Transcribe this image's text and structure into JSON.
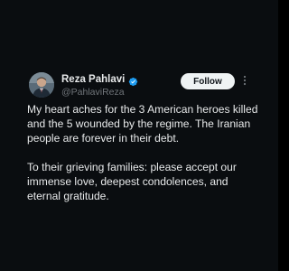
{
  "author": {
    "display_name": "Reza Pahlavi",
    "handle": "@PahlaviReza",
    "verified": true
  },
  "follow_label": "Follow",
  "tweet": {
    "paragraph_1": "My heart aches for the 3 American heroes killed and the 5 wounded by the regime. The Iranian people are forever in their debt.",
    "paragraph_2": "To their grieving families: please accept our immense love, deepest condolences, and eternal gratitude."
  },
  "icons": {
    "verified": "verified-badge-icon",
    "more": "more-options-icon"
  },
  "colors": {
    "background": "#0a0d10",
    "text": "#e7e9ea",
    "secondary_text": "#71767b",
    "verified_blue": "#1d9bf0",
    "button_bg": "#eff3f4"
  }
}
